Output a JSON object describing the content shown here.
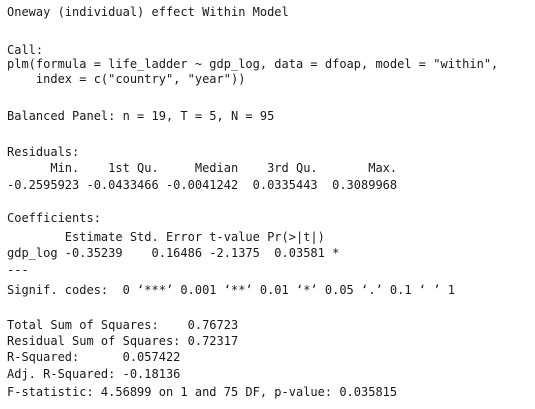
{
  "console": {
    "lines": [
      "Oneway (individual) effect Within Model",
      "Call:",
      "plm(formula = life_ladder ~ gdp_log, data = dfoap, model = \"within\",",
      "    index = c(\"country\", \"year\"))",
      "Balanced Panel: n = 19, T = 5, N = 95",
      "Residuals:",
      "      Min.    1st Qu.     Median    3rd Qu.       Max.",
      "-0.2595923 -0.0433466 -0.0041242  0.0335443  0.3089968",
      "Coefficients:",
      "        Estimate Std. Error t-value Pr(>|t|)",
      "gdp_log -0.35239    0.16486 -2.1375  0.03581 *",
      "---",
      "Signif. codes:  0 ‘***’ 0.001 ‘**’ 0.01 ‘*’ 0.05 ‘.’ 0.1 ‘ ’ 1",
      "Total Sum of Squares:    0.76723",
      "Residual Sum of Squares: 0.72317",
      "R-Squared:      0.057422",
      "Adj. R-Squared: -0.18136",
      "F-statistic: 4.56899 on 1 and 75 DF, p-value: 0.035815"
    ]
  }
}
